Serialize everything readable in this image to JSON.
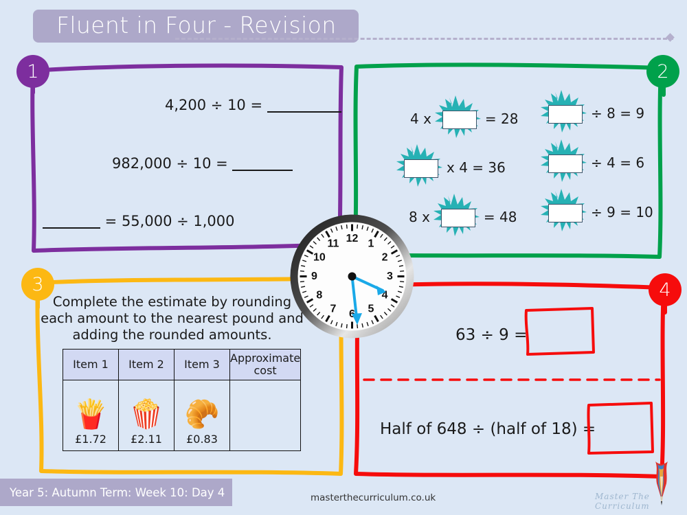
{
  "header": {
    "title": "Fluent in Four - Revision"
  },
  "panels": [
    {
      "number": "1",
      "color": "#7d2e9e",
      "name": "division-by-powers-of-ten",
      "lines": [
        {
          "before": "4,200 ÷ 10 = ",
          "blank": "________",
          "after": ""
        },
        {
          "before": "982,000 ÷ 10 = ",
          "blank": "_______",
          "after": ""
        },
        {
          "before": "",
          "blank": "_______",
          "after": " = 55,000 ÷ 1,000"
        }
      ]
    },
    {
      "number": "2",
      "color": "#00a14b",
      "name": "missing-number-splats",
      "items": [
        {
          "prefix": "4 x",
          "suffix": "= 28"
        },
        {
          "prefix": "",
          "suffix": "x 4 = 36"
        },
        {
          "prefix": "8 x",
          "suffix": "= 48"
        },
        {
          "prefix": "",
          "suffix": "÷ 8 = 9"
        },
        {
          "prefix": "",
          "suffix": "÷ 4 = 6"
        },
        {
          "prefix": "",
          "suffix": "÷ 9 = 10"
        }
      ]
    },
    {
      "number": "3",
      "color": "#fcb813",
      "name": "estimate-by-rounding",
      "instruction": "Complete the estimate by rounding each amount to the nearest pound and adding the rounded amounts.",
      "table": {
        "headers": [
          "Item 1",
          "Item 2",
          "Item 3",
          "Approximate cost"
        ],
        "row": [
          {
            "emoji": "🍟",
            "icon_name": "fries-icon",
            "price": "£1.72"
          },
          {
            "emoji": "🍿",
            "icon_name": "popcorn-icon",
            "price": "£2.11"
          },
          {
            "emoji": "🥐",
            "icon_name": "croissant-icon",
            "price": "£0.83"
          },
          {
            "emoji": "",
            "icon_name": "empty-answer-cell",
            "price": ""
          }
        ]
      }
    },
    {
      "number": "4",
      "color": "#f60c0c",
      "name": "division-problems",
      "lines": [
        {
          "text": "63 ÷ 9 ="
        },
        {
          "text": "Half of 648 ÷ (half of 18) ="
        }
      ]
    }
  ],
  "clock": {
    "name": "analogue-clock",
    "numerals": [
      "12",
      "1",
      "2",
      "3",
      "4",
      "5",
      "6",
      "7",
      "8",
      "9",
      "10",
      "11"
    ],
    "hour_hand_angle": 105,
    "minute_hand_angle": 175,
    "hand_color": "#1aa9e8"
  },
  "footer": {
    "lesson": "Year 5: Autumn Term: Week 10: Day 4",
    "url": "masterthecurriculum.co.uk",
    "brand": "Master The Curriculum"
  },
  "colors": {
    "background": "#dce7f5",
    "title_bar": "#ada8c9",
    "splat": "#26b1b4",
    "table_header": "#d2d9f3"
  }
}
